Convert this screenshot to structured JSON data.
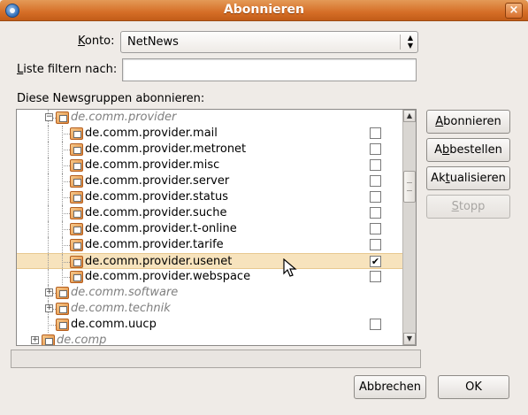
{
  "window": {
    "title": "Abonnieren",
    "close_label": "×"
  },
  "form": {
    "account_label": "Konto:",
    "account_value": "NetNews",
    "filter_label": "Liste filtern nach:",
    "filter_value": "",
    "list_label": "Diese Newsgruppen abonnieren:"
  },
  "tree": {
    "rows": [
      {
        "label": "de.comm.provider",
        "level": 2,
        "dim": true,
        "expander": "−",
        "checkbox": false,
        "checked": false,
        "selected": false
      },
      {
        "label": "de.comm.provider.mail",
        "level": 3,
        "dim": false,
        "expander": "",
        "checkbox": true,
        "checked": false,
        "selected": false
      },
      {
        "label": "de.comm.provider.metronet",
        "level": 3,
        "dim": false,
        "expander": "",
        "checkbox": true,
        "checked": false,
        "selected": false
      },
      {
        "label": "de.comm.provider.misc",
        "level": 3,
        "dim": false,
        "expander": "",
        "checkbox": true,
        "checked": false,
        "selected": false
      },
      {
        "label": "de.comm.provider.server",
        "level": 3,
        "dim": false,
        "expander": "",
        "checkbox": true,
        "checked": false,
        "selected": false
      },
      {
        "label": "de.comm.provider.status",
        "level": 3,
        "dim": false,
        "expander": "",
        "checkbox": true,
        "checked": false,
        "selected": false
      },
      {
        "label": "de.comm.provider.suche",
        "level": 3,
        "dim": false,
        "expander": "",
        "checkbox": true,
        "checked": false,
        "selected": false
      },
      {
        "label": "de.comm.provider.t-online",
        "level": 3,
        "dim": false,
        "expander": "",
        "checkbox": true,
        "checked": false,
        "selected": false
      },
      {
        "label": "de.comm.provider.tarife",
        "level": 3,
        "dim": false,
        "expander": "",
        "checkbox": true,
        "checked": false,
        "selected": false
      },
      {
        "label": "de.comm.provider.usenet",
        "level": 3,
        "dim": false,
        "expander": "",
        "checkbox": true,
        "checked": true,
        "selected": true
      },
      {
        "label": "de.comm.provider.webspace",
        "level": 3,
        "dim": false,
        "expander": "",
        "checkbox": true,
        "checked": false,
        "selected": false
      },
      {
        "label": "de.comm.software",
        "level": 2,
        "dim": true,
        "expander": "+",
        "checkbox": false,
        "checked": false,
        "selected": false
      },
      {
        "label": "de.comm.technik",
        "level": 2,
        "dim": true,
        "expander": "+",
        "checkbox": false,
        "checked": false,
        "selected": false
      },
      {
        "label": "de.comm.uucp",
        "level": 2,
        "dim": false,
        "expander": "",
        "checkbox": true,
        "checked": false,
        "selected": false
      },
      {
        "label": "de.comp",
        "level": 1,
        "dim": true,
        "expander": "+",
        "checkbox": false,
        "checked": false,
        "selected": false
      }
    ]
  },
  "scrollbar": {
    "position_fraction": 0.28,
    "up_icon": "▲",
    "down_icon": "▼"
  },
  "buttons": {
    "subscribe": "Abonnieren",
    "unsubscribe": "Abbestellen",
    "refresh": "Aktualisieren",
    "stop": "Stopp",
    "cancel": "Abbrechen",
    "ok": "OK"
  },
  "icons": {
    "app": "thunderbird-icon",
    "folder": "newsgroup-folder-icon",
    "check": "✔",
    "cursor": "mouse-pointer-icon"
  }
}
